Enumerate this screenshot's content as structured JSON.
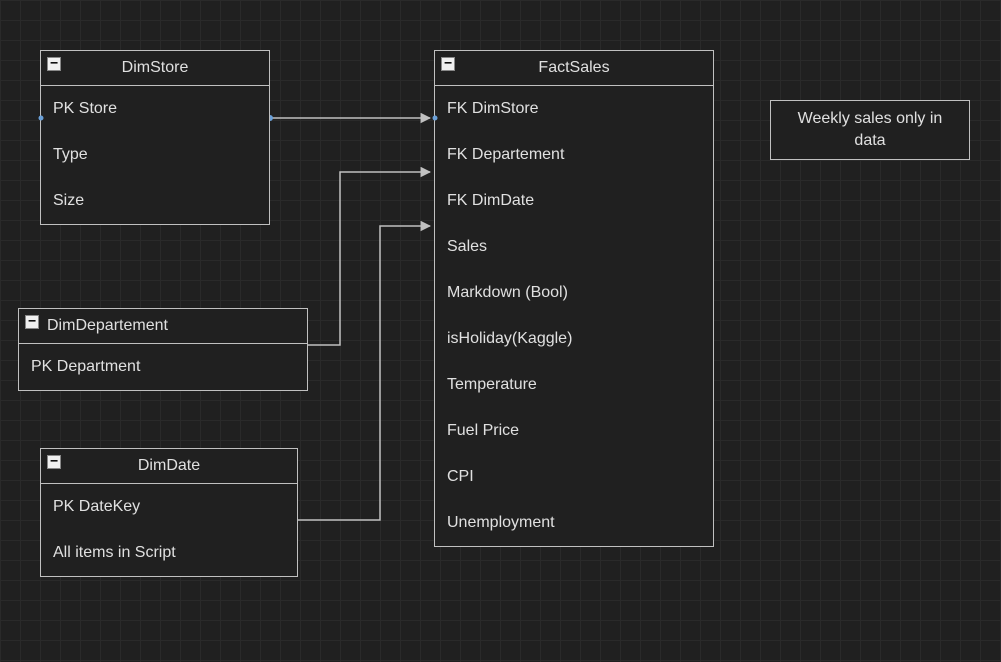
{
  "entities": {
    "dimstore": {
      "title": "DimStore",
      "rows": [
        "PK Store",
        "Type",
        "Size"
      ]
    },
    "dimdepartement": {
      "title": "DimDepartement",
      "rows": [
        "PK Department"
      ]
    },
    "dimdate": {
      "title": "DimDate",
      "rows": [
        "PK DateKey",
        "All items in Script"
      ]
    },
    "factsales": {
      "title": "FactSales",
      "rows": [
        "FK DimStore",
        "FK Departement",
        "FK DimDate",
        "Sales",
        "Markdown (Bool)",
        "isHoliday(Kaggle)",
        "Temperature",
        "Fuel Price",
        "CPI",
        "Unemployment"
      ]
    }
  },
  "note": {
    "text": "Weekly sales only in data"
  },
  "collapse_glyph": "−"
}
